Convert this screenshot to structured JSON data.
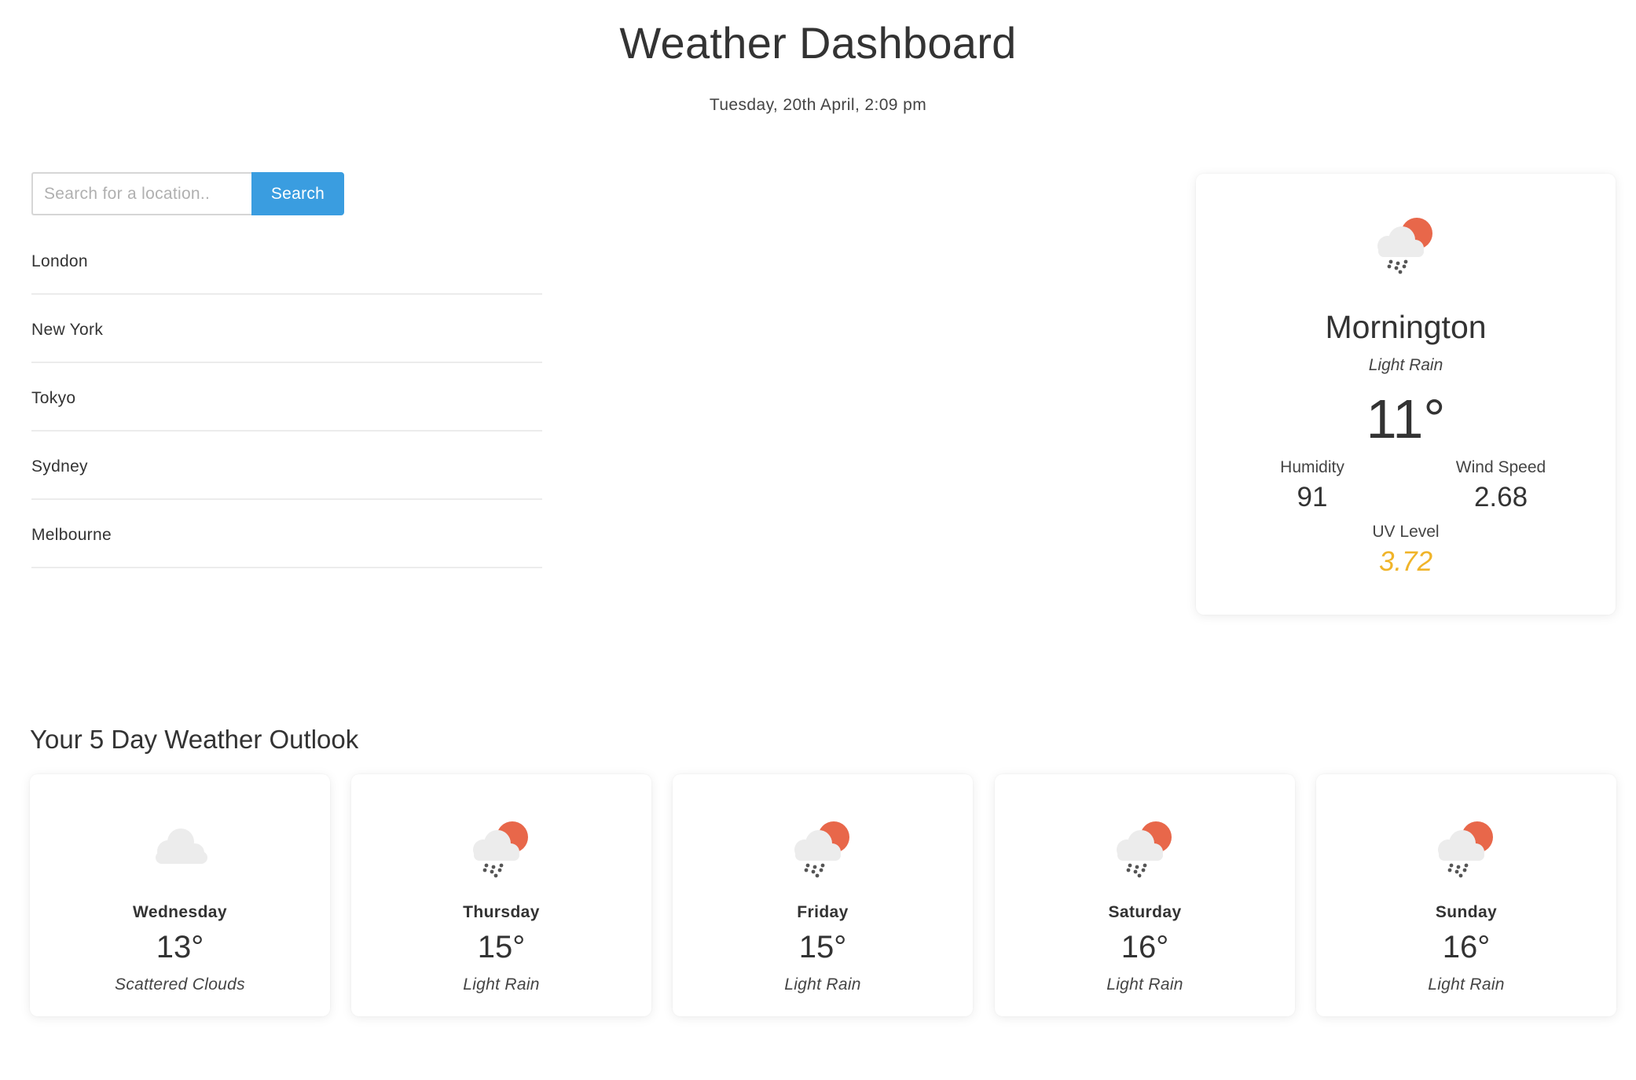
{
  "header": {
    "title": "Weather Dashboard",
    "datetime": "Tuesday, 20th April, 2:09 pm"
  },
  "search": {
    "placeholder": "Search for a location..",
    "value": "",
    "button_label": "Search"
  },
  "locations": [
    "London",
    "New York",
    "Tokyo",
    "Sydney",
    "Melbourne"
  ],
  "current": {
    "city": "Mornington",
    "description": "Light Rain",
    "icon": "rain-sun-icon",
    "temperature": "11°",
    "humidity_label": "Humidity",
    "humidity": "91",
    "wind_label": "Wind Speed",
    "wind": "2.68",
    "uv_label": "UV Level",
    "uv": "3.72"
  },
  "outlook": {
    "title": "Your 5 Day Weather Outlook",
    "days": [
      {
        "day": "Wednesday",
        "temp": "13°",
        "description": "Scattered Clouds",
        "icon": "cloud-icon"
      },
      {
        "day": "Thursday",
        "temp": "15°",
        "description": "Light Rain",
        "icon": "rain-sun-icon"
      },
      {
        "day": "Friday",
        "temp": "15°",
        "description": "Light Rain",
        "icon": "rain-sun-icon"
      },
      {
        "day": "Saturday",
        "temp": "16°",
        "description": "Light Rain",
        "icon": "rain-sun-icon"
      },
      {
        "day": "Sunday",
        "temp": "16°",
        "description": "Light Rain",
        "icon": "rain-sun-icon"
      }
    ]
  },
  "colors": {
    "accent": "#3a9de0",
    "uv": "#f0b429",
    "sun": "#e8674a",
    "cloud": "#ececec",
    "rain": "#555555"
  }
}
